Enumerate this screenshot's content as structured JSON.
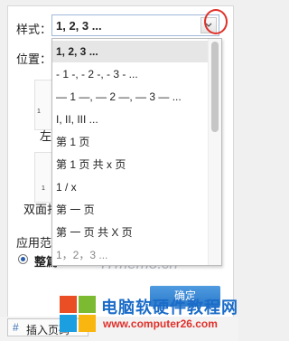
{
  "style_label": "样式：",
  "selected_style": "1, 2, 3 ...",
  "position_label": "位置：",
  "page_icons": [
    {
      "num": "1"
    },
    {
      "num": "1"
    }
  ],
  "captions": {
    "left": "左",
    "double": "双面打"
  },
  "apply_label": "应用范",
  "radio_label": "整篇",
  "ok_button": "确定",
  "insert_button": "插入页码",
  "dropdown_options": [
    "1, 2, 3 ...",
    "- 1 -, - 2 -, - 3 - ...",
    "— 1 —, — 2 —, — 3 — ...",
    "I, II, III ...",
    "第 1 页",
    "第 1 页 共 x 页",
    "1 / x",
    "第 一 页",
    "第 一 页 共 X 页",
    "1，2，3 ..."
  ],
  "watermark": "ITmemo.cn",
  "logo": {
    "title": "电脑软硬件教程网",
    "url": "www.computer26.com"
  },
  "colors": {
    "accent": "#2c7acb",
    "highlight_ring": "#e0302a"
  }
}
